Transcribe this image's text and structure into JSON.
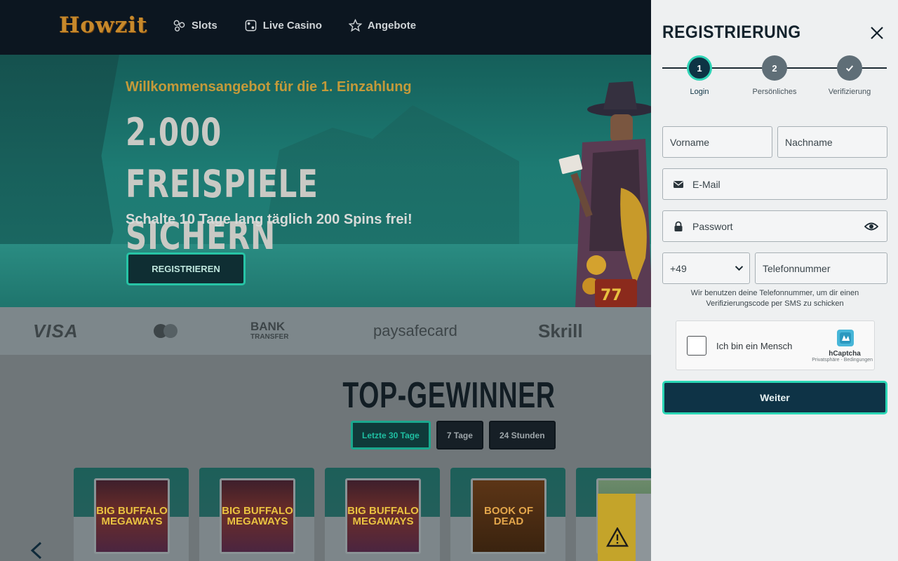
{
  "header": {
    "logo": "Howzit",
    "nav": [
      {
        "label": "Slots",
        "icon": "slot-icon"
      },
      {
        "label": "Live Casino",
        "icon": "dice-icon"
      },
      {
        "label": "Angebote",
        "icon": "star-icon"
      }
    ]
  },
  "hero": {
    "kicker": "Willkommensangebot für die 1. Einzahlung",
    "title": "2.000 FREISPIELE SICHERN",
    "subtitle": "Schalte 10 Tage lang täglich 200 Spins frei!",
    "button": "REGISTRIEREN"
  },
  "payments": {
    "visa": "VISA",
    "bank": "BANK",
    "bank_sub": "TRANSFER",
    "paysafe": "paysafecard",
    "skrill": "Skrill"
  },
  "top_winners": {
    "title": "TOP-GEWINNER",
    "tabs": [
      "Letzte 30 Tage",
      "7 Tage",
      "24 Stunden"
    ],
    "active_tab": "Letzte 30 Tage",
    "cards": [
      {
        "game": "BIG BUFFALO MEGAWAYS"
      },
      {
        "game": "BIG BUFFALO MEGAWAYS"
      },
      {
        "game": "BIG BUFFALO MEGAWAYS"
      },
      {
        "game": "BOOK OF DEAD"
      },
      {
        "game": ""
      }
    ]
  },
  "registration": {
    "title": "REGISTRIERUNG",
    "steps": [
      {
        "number": "1",
        "label": "Login"
      },
      {
        "number": "2",
        "label": "Persönliches"
      },
      {
        "number": "✓",
        "label": "Verifizierung"
      }
    ],
    "fields": {
      "first_name": "Vorname",
      "last_name": "Nachname",
      "email": "E-Mail",
      "password": "Passwort",
      "country_code": "+49",
      "phone": "Telefonnummer"
    },
    "phone_hint": "Wir benutzen deine Telefonnummer, um dir einen Verifizierungscode per SMS zu schicken",
    "captcha": {
      "label": "Ich bin ein Mensch",
      "brand": "hCaptcha",
      "links": "Privatsphäre - Bedingungen"
    },
    "submit": "Weiter"
  },
  "colors": {
    "accent": "#2ad6b5",
    "brand": "#c7892b",
    "dark": "#0e3346"
  }
}
